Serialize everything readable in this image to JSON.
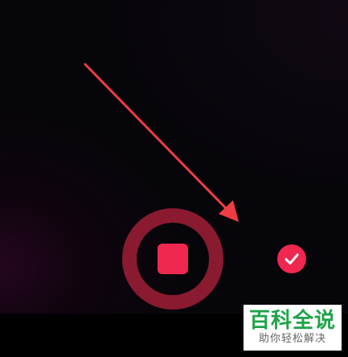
{
  "colors": {
    "background": "#000000",
    "record_ring": "#8a1a30",
    "stop_button": "#f02850",
    "confirm_button": "#f02850",
    "confirm_check": "#ffffff",
    "annotation_arrow": "#f03c44",
    "watermark_title": "#1fa34a",
    "watermark_subtitle": "#666666"
  },
  "controls": {
    "record": {
      "state": "recording",
      "icon": "stop-icon"
    },
    "confirm": {
      "icon": "check-icon"
    }
  },
  "annotation": {
    "icon": "arrow-icon"
  },
  "watermark": {
    "title": "百科全说",
    "subtitle": "助你轻松解决"
  }
}
